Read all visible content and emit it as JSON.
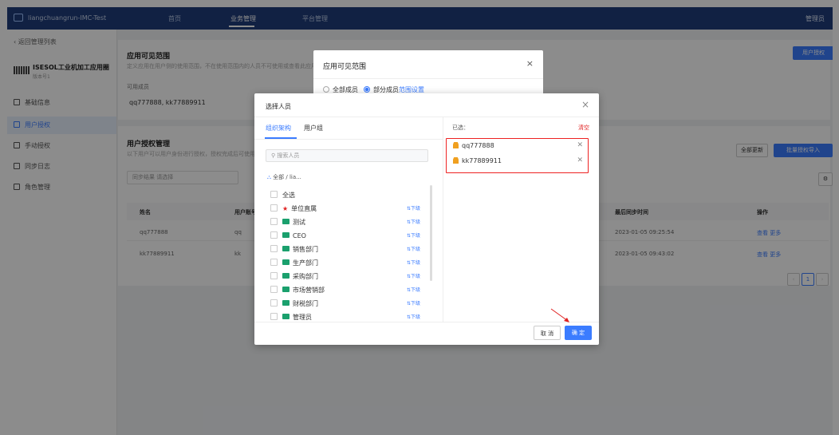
{
  "topbar": {
    "app_title": "liangchuangrun-IMC-Test",
    "nav": [
      "首页",
      "业务管理",
      "平台管理"
    ],
    "user": "管理员"
  },
  "sidebar": {
    "back": "返回管理列表",
    "app_name": "ISESOL工业机加工应用圈",
    "app_version": "版本号1",
    "items": [
      "基础信息",
      "用户授权",
      "手动授权",
      "同步日志",
      "角色管理"
    ],
    "active_index": 1
  },
  "visible_range": {
    "title": "应用可见范围",
    "desc": "定义应用在用户侧的使用范围，不在使用范围内的人员不可使用或查看此应用",
    "members_label": "可用成员",
    "members": "qq777888, kk77889911",
    "auth_button": "用户授权"
  },
  "user_auth": {
    "title": "用户授权管理",
    "desc": "以下用户可以用户身份进行授权，授权完成后可使用",
    "filter_label": "同步结果",
    "filter_value": "请选择",
    "btn_update": "全部更新",
    "btn_import": "批量授权导入",
    "columns": [
      "姓名",
      "用户账号",
      "最后同步时间",
      "操作"
    ],
    "rows": [
      {
        "name": "qq777888",
        "account": "qq",
        "time": "2023-01-05 09:25:54",
        "ops": "查看 更多"
      },
      {
        "name": "kk77889911",
        "account": "kk",
        "time": "2023-01-05 09:43:02",
        "ops": "查看 更多"
      }
    ],
    "page": "1"
  },
  "range_dialog": {
    "title": "应用可见范围",
    "option_all": "全部成员",
    "option_part": "部分成员",
    "range_link": "范围设置"
  },
  "select_dialog": {
    "title": "选择人员",
    "tabs": [
      "组织架构",
      "用户组"
    ],
    "search_placeholder": "搜索人员",
    "breadcrumb": {
      "root": "全部",
      "sep": "/",
      "current": "lia..."
    },
    "select_all": "全选",
    "tree": [
      {
        "name": "单位直属",
        "icon": "star-icon"
      },
      {
        "name": "测试",
        "icon": "folder-icon"
      },
      {
        "name": "CEO",
        "icon": "folder-icon"
      },
      {
        "name": "销售部门",
        "icon": "folder-icon"
      },
      {
        "name": "生产部门",
        "icon": "folder-icon"
      },
      {
        "name": "采购部门",
        "icon": "folder-icon"
      },
      {
        "name": "市场营销部",
        "icon": "folder-icon"
      },
      {
        "name": "财税部门",
        "icon": "folder-icon"
      },
      {
        "name": "管理员",
        "icon": "folder-icon"
      }
    ],
    "sub_label": "下级",
    "selected_label": "已选：",
    "clear_label": "清空",
    "selected": [
      "qq777888",
      "kk77889911"
    ],
    "cancel": "取 消",
    "confirm": "确 定"
  },
  "colors": {
    "primary": "#3b7cff",
    "topbar": "#1f3d7a",
    "highlight": "#e22222"
  }
}
